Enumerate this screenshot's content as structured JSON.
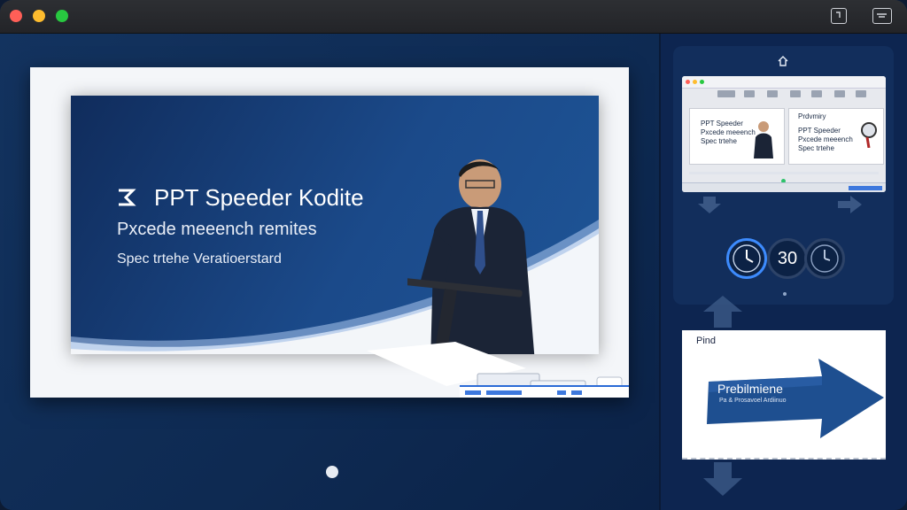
{
  "window": {
    "traffic_lights": [
      "close",
      "minimize",
      "zoom"
    ],
    "toolbar_icons": [
      "rotate-icon",
      "keyboard-icon"
    ]
  },
  "slide": {
    "title": "PPT Speeder Kodite",
    "subtitle": "Pxcede meeench remites",
    "tagline": "Spec trtehe Veratioerstard",
    "logo_icon": "logo-icon"
  },
  "sidebar": {
    "home_icon": "home-icon",
    "thumbnail": {
      "left_card_text": [
        "PPT Speeder",
        "Pxcede meeench",
        "Spec trtehe"
      ],
      "right_card_label": "Prdvmiry",
      "right_card_text": [
        "PPT Speeder",
        "Pxcede meeench",
        "Spec trtehe"
      ]
    },
    "timers": [
      "",
      "30",
      ""
    ],
    "preview": {
      "label": "Pind",
      "title": "Prebilmiene",
      "subtitle": "Pa & Prosavoel Ardiinuo"
    }
  },
  "colors": {
    "window_bg": "#0f2a55",
    "slide_accent": "#1b4a8a",
    "timer_ring": "#3d8bfd"
  }
}
